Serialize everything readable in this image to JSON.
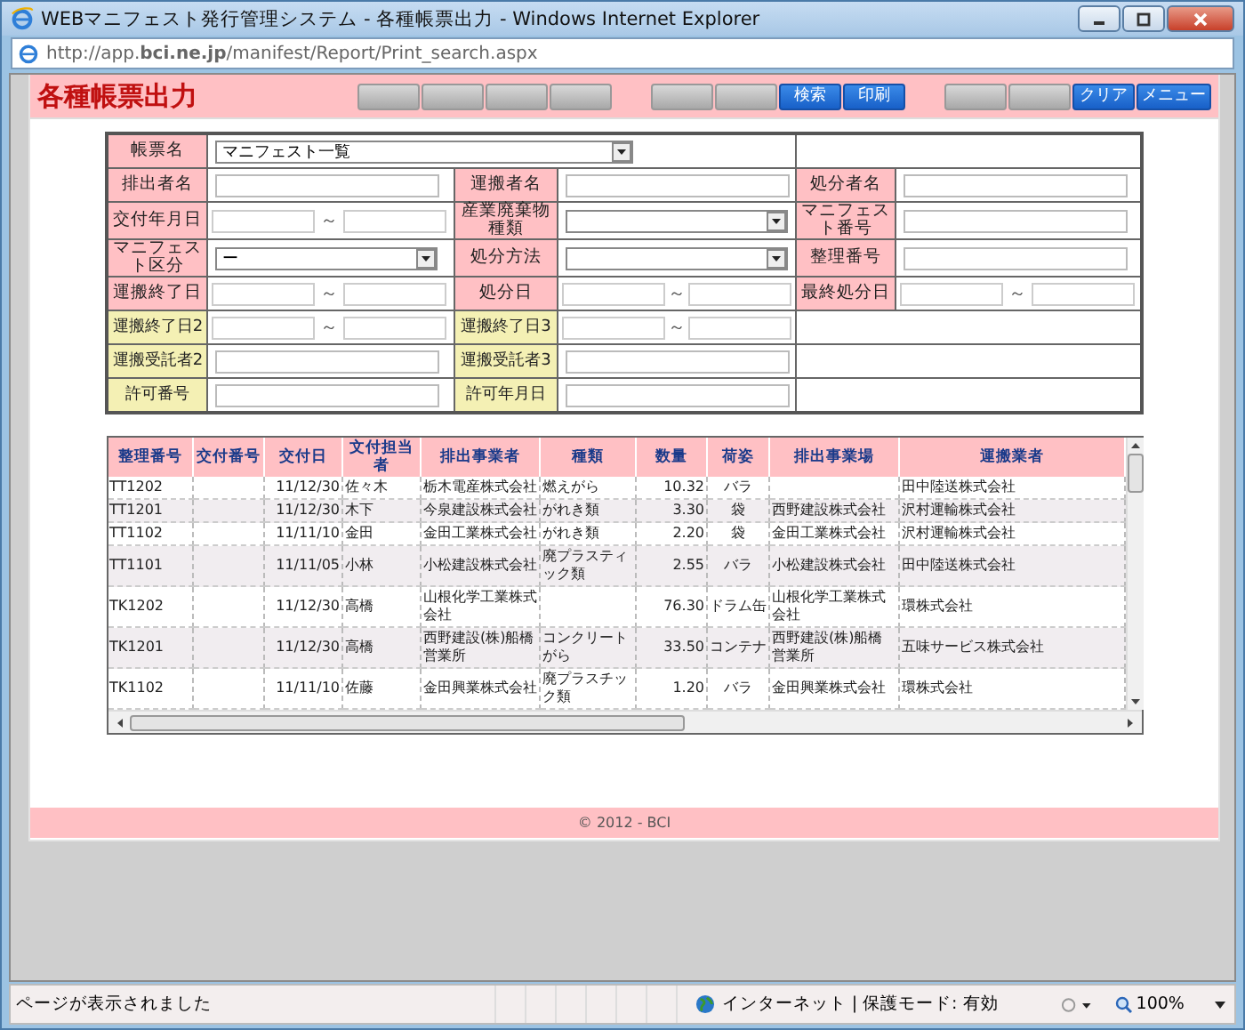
{
  "window": {
    "title": "WEBマニフェスト発行管理システム - 各種帳票出力 - Windows Internet Explorer",
    "address": "http://app.**bci.ne.jp**/manifest/Report/Print_search.aspx"
  },
  "header": {
    "title": "各種帳票出力",
    "buttons": [
      {
        "kind": "blank"
      },
      {
        "kind": "blank"
      },
      {
        "kind": "blank"
      },
      {
        "kind": "blank"
      },
      {
        "kind": "gap"
      },
      {
        "kind": "blank"
      },
      {
        "kind": "blank"
      },
      {
        "kind": "action",
        "label": "検索"
      },
      {
        "kind": "action",
        "label": "印刷"
      },
      {
        "kind": "gap"
      },
      {
        "kind": "blank"
      },
      {
        "kind": "blank"
      },
      {
        "kind": "action",
        "label": "クリア"
      },
      {
        "kind": "action",
        "label": "メニュー"
      }
    ]
  },
  "form": {
    "rows": [
      [
        {
          "kind": "label",
          "text": "帳票名"
        },
        {
          "kind": "select",
          "value": "マニフェスト一覧",
          "colspan": 3
        },
        {
          "kind": "blank",
          "colspan": 2
        }
      ],
      [
        {
          "kind": "label",
          "text": "排出者名"
        },
        {
          "kind": "text"
        },
        {
          "kind": "label",
          "text": "運搬者名"
        },
        {
          "kind": "text"
        },
        {
          "kind": "label",
          "text": "処分者名"
        },
        {
          "kind": "text"
        }
      ],
      [
        {
          "kind": "label",
          "text": "交付年月日"
        },
        {
          "kind": "range",
          "separator": "～"
        },
        {
          "kind": "label",
          "text": "産業廃棄物種類"
        },
        {
          "kind": "select"
        },
        {
          "kind": "label",
          "text": "マニフェスト番号"
        },
        {
          "kind": "text"
        }
      ],
      [
        {
          "kind": "label",
          "text": "マニフェスト区分"
        },
        {
          "kind": "select",
          "value": "ー"
        },
        {
          "kind": "label",
          "text": "処分方法"
        },
        {
          "kind": "select"
        },
        {
          "kind": "label",
          "text": "整理番号"
        },
        {
          "kind": "text"
        }
      ],
      [
        {
          "kind": "label",
          "text": "運搬終了日"
        },
        {
          "kind": "range",
          "separator": "～"
        },
        {
          "kind": "label",
          "text": "処分日"
        },
        {
          "kind": "range",
          "separator": "～"
        },
        {
          "kind": "label",
          "text": "最終処分日"
        },
        {
          "kind": "range",
          "separator": "～"
        }
      ],
      [
        {
          "kind": "sublabel",
          "text": "運搬終了日2"
        },
        {
          "kind": "range",
          "separator": "～"
        },
        {
          "kind": "sublabel",
          "text": "運搬終了日3"
        },
        {
          "kind": "range",
          "separator": "～"
        },
        {
          "kind": "blank",
          "colspan": 2
        }
      ],
      [
        {
          "kind": "sublabel",
          "text": "運搬受託者2"
        },
        {
          "kind": "text"
        },
        {
          "kind": "sublabel",
          "text": "運搬受託者3"
        },
        {
          "kind": "text"
        },
        {
          "kind": "blank",
          "colspan": 2
        }
      ],
      [
        {
          "kind": "sublabel",
          "text": "許可番号"
        },
        {
          "kind": "text"
        },
        {
          "kind": "sublabel",
          "text": "許可年月日"
        },
        {
          "kind": "text"
        },
        {
          "kind": "blank",
          "colspan": 2
        }
      ]
    ]
  },
  "table": {
    "columns": [
      "整理番号",
      "交付番号",
      "交付日",
      "文付担当者",
      "排出事業者",
      "種類",
      "数量",
      "荷姿",
      "排出事業場",
      "運搬業者"
    ],
    "rows": [
      [
        "TT1202",
        "",
        "11/12/30",
        "佐々木",
        "栃木電産株式会社",
        "燃えがら",
        "10.32",
        "バラ",
        "",
        "田中陸送株式会社"
      ],
      [
        "TT1201",
        "",
        "11/12/30",
        "木下",
        "今泉建設株式会社",
        "がれき類",
        "3.30",
        "袋",
        "西野建設株式会社",
        "沢村運輸株式会社"
      ],
      [
        "TT1102",
        "",
        "11/11/10",
        "金田",
        "金田工業株式会社",
        "がれき類",
        "2.20",
        "袋",
        "金田工業株式会社",
        "沢村運輸株式会社"
      ],
      [
        "TT1101",
        "",
        "11/11/05",
        "小林",
        "小松建設株式会社",
        "廃プラスティック類",
        "2.55",
        "バラ",
        "小松建設株式会社",
        "田中陸送株式会社"
      ],
      [
        "TK1202",
        "",
        "11/12/30",
        "高橋",
        "山根化学工業株式会社",
        "",
        "76.30",
        "ドラム缶",
        "山根化学工業株式会社",
        "環株式会社"
      ],
      [
        "TK1201",
        "",
        "11/12/30",
        "高橋",
        "西野建設(株)船橋営業所",
        "コンクリートがら",
        "33.50",
        "コンテナ",
        "西野建設(株)船橋営業所",
        "五味サービス株式会社"
      ],
      [
        "TK1102",
        "",
        "11/11/10",
        "佐藤",
        "金田興業株式会社",
        "廃プラスチック類",
        "1.20",
        "バラ",
        "金田興業株式会社",
        "環株式会社"
      ]
    ]
  },
  "footer": "© 2012 - BCI",
  "status_bar": {
    "message": "ページが表示されました",
    "zone": "インターネット | 保護モード: 有効",
    "zoom": "100%"
  }
}
